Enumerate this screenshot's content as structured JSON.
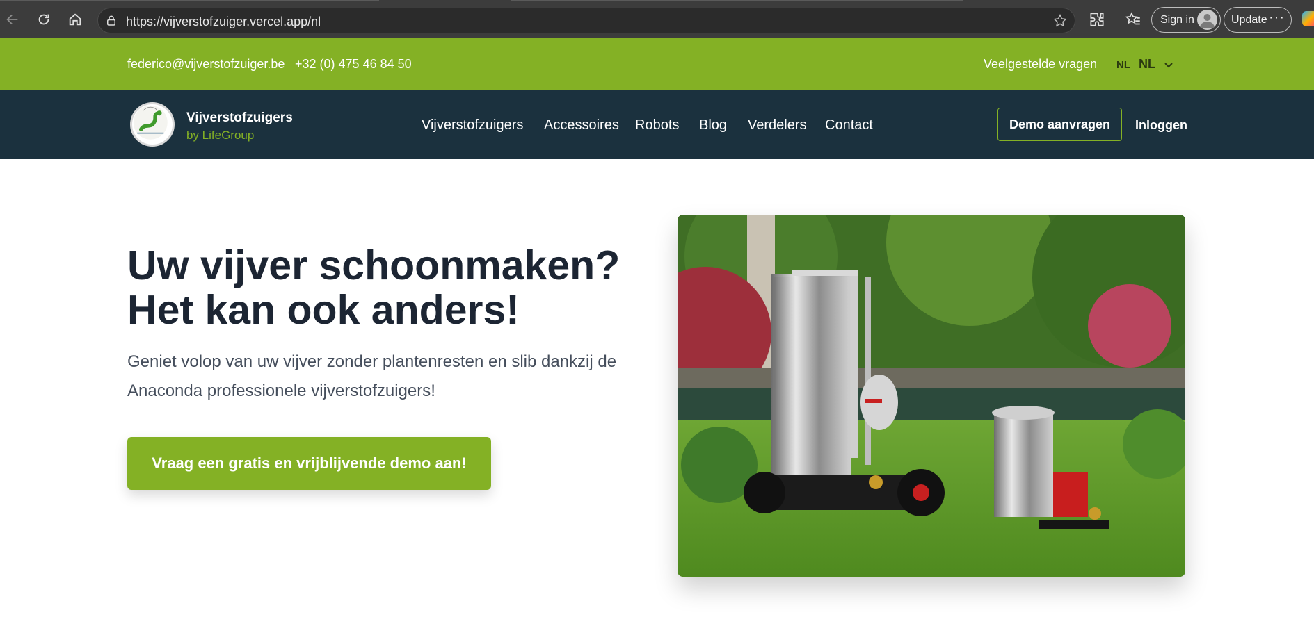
{
  "browser": {
    "url": "https://vijverstofzuiger.vercel.app/nl",
    "sign_in_label": "Sign in",
    "update_label": "Update",
    "more_label": "···",
    "icons": [
      "back-icon",
      "refresh-icon",
      "home-icon",
      "lock-icon",
      "star-icon",
      "extensions-icon",
      "favorites-icon",
      "profile-icon",
      "more-icon",
      "copilot-icon"
    ]
  },
  "topbar": {
    "email": "federico@vijverstofzuiger.be",
    "phone": "+32 (0) 475 46 84 50",
    "faq": "Veelgestelde vragen",
    "lang_code": "NL",
    "lang_selected": "NL"
  },
  "nav": {
    "brand_name": "Vijverstofzuigers",
    "brand_sub": "by LifeGroup",
    "items": [
      "Vijverstofzuigers",
      "Accessoires",
      "Robots",
      "Blog",
      "Verdelers",
      "Contact"
    ],
    "demo_button": "Demo aanvragen",
    "login": "Inloggen"
  },
  "hero": {
    "title_line1": "Uw vijver schoonmaken?",
    "title_line2": "Het kan ook anders!",
    "text": "Geniet volop van uw vijver zonder plantenresten en slib dankzij de Anaconda professionele vijverstofzuigers!",
    "cta": "Vraag een gratis en vrijblijvende demo aan!"
  },
  "colors": {
    "brand_green": "#84b125",
    "nav_dark": "#1b313e",
    "title_dark": "#1c2533"
  }
}
